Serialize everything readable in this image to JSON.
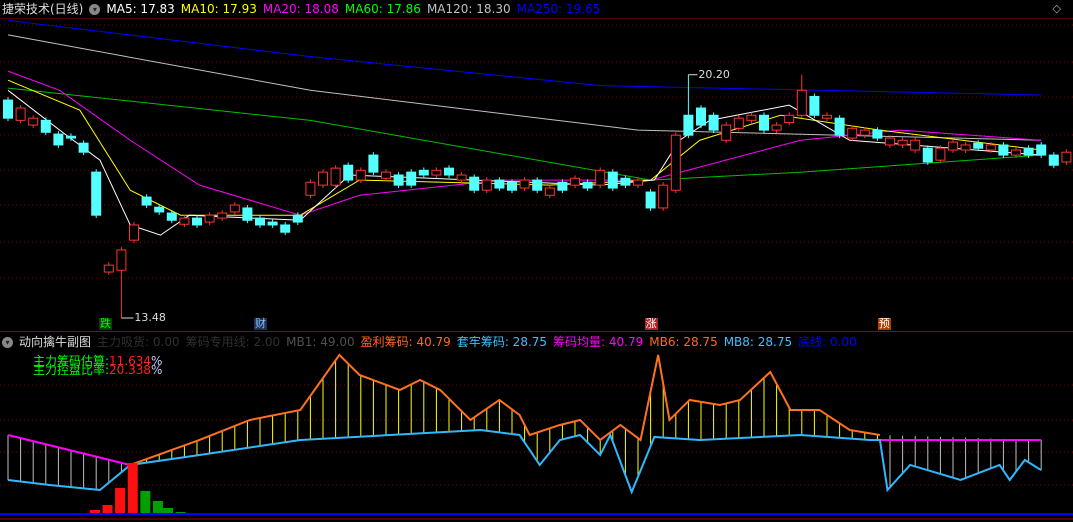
{
  "main": {
    "title": "捷荣技术(日线)",
    "ma": [
      {
        "label": "MA5: 17.83",
        "color": "#ffffff"
      },
      {
        "label": "MA10: 17.93",
        "color": "#ffff00"
      },
      {
        "label": "MA20: 18.08",
        "color": "#ff00ff"
      },
      {
        "label": "MA60: 17.86",
        "color": "#00ff00"
      },
      {
        "label": "MA120: 18.30",
        "color": "#c0c0c0"
      },
      {
        "label": "MA250: 19.65",
        "color": "#0000ff"
      }
    ],
    "high_label": "20.20",
    "low_label": "13.48",
    "markers": [
      {
        "text": "跌",
        "color": "#00ff00",
        "bg": "#004000",
        "idx": 7.7
      },
      {
        "text": "财",
        "color": "#80c0ff",
        "bg": "#203050",
        "idx": 20
      },
      {
        "text": "涨",
        "color": "#ffffff",
        "bg": "#b02020",
        "idx": 51
      },
      {
        "text": "预",
        "color": "#ffffff",
        "bg": "#b04000",
        "idx": 69.5
      }
    ]
  },
  "sub": {
    "title": "动向擒牛副图",
    "indicators": [
      {
        "label": "主力吸货: 0.00",
        "color": "#303030"
      },
      {
        "label": "筹码专用线: 2.00",
        "color": "#303030"
      },
      {
        "label": "MB1: 49.00",
        "color": "#505050"
      },
      {
        "label": "盈利筹码: 40.79",
        "color": "#ff6a20"
      },
      {
        "label": "套牢筹码: 28.75",
        "color": "#40c0ff"
      },
      {
        "label": "筹码均量: 40.79",
        "color": "#ff00ff"
      },
      {
        "label": "MB6: 28.75",
        "color": "#ff6a20"
      },
      {
        "label": "MB8: 28.75",
        "color": "#40c0ff"
      },
      {
        "label": "底线: 0.00",
        "color": "#0000ff"
      }
    ],
    "overlay1_label": "主力筹码估算:",
    "overlay1_value": "11.634",
    "overlay2_label": "主力控盘比率:",
    "overlay2_value": "20.338",
    "percent": "%"
  },
  "colors": {
    "up": "#ff3232",
    "down": "#54ffff",
    "grid": "#800000"
  },
  "chart_data": {
    "type": "candlestick",
    "price_range": [
      13.0,
      21.9
    ],
    "candles": [
      [
        19.5,
        19.0
      ],
      [
        18.94,
        19.28
      ],
      [
        18.81,
        19.0
      ],
      [
        18.94,
        18.61
      ],
      [
        18.56,
        18.26
      ],
      [
        18.5,
        18.45
      ],
      [
        18.31,
        18.06
      ],
      [
        17.51,
        16.32
      ],
      [
        14.75,
        14.94
      ],
      [
        14.8,
        15.36
      ],
      [
        15.63,
        16.05
      ],
      [
        16.82,
        16.6
      ],
      [
        16.54,
        16.41
      ],
      [
        16.38,
        16.18
      ],
      [
        16.07,
        16.24
      ],
      [
        16.24,
        16.05
      ],
      [
        16.13,
        16.32
      ],
      [
        16.24,
        16.38
      ],
      [
        16.41,
        16.6
      ],
      [
        16.52,
        16.18
      ],
      [
        16.24,
        16.05
      ],
      [
        16.13,
        16.05
      ],
      [
        16.05,
        15.85
      ],
      [
        16.32,
        16.13
      ],
      [
        16.87,
        17.23
      ],
      [
        17.15,
        17.51
      ],
      [
        17.15,
        17.62
      ],
      [
        17.7,
        17.29
      ],
      [
        17.29,
        17.56
      ],
      [
        17.98,
        17.51
      ],
      [
        17.34,
        17.51
      ],
      [
        17.43,
        17.15
      ],
      [
        17.51,
        17.15
      ],
      [
        17.56,
        17.43
      ],
      [
        17.43,
        17.56
      ],
      [
        17.62,
        17.43
      ],
      [
        17.29,
        17.43
      ],
      [
        17.37,
        17.01
      ],
      [
        17.01,
        17.29
      ],
      [
        17.29,
        17.07
      ],
      [
        17.23,
        17.01
      ],
      [
        17.07,
        17.29
      ],
      [
        17.29,
        17.01
      ],
      [
        16.87,
        17.07
      ],
      [
        17.23,
        17.01
      ],
      [
        17.15,
        17.34
      ],
      [
        17.23,
        17.07
      ],
      [
        17.15,
        17.56
      ],
      [
        17.51,
        17.07
      ],
      [
        17.34,
        17.15
      ],
      [
        17.15,
        17.29
      ],
      [
        16.96,
        16.52
      ],
      [
        16.52,
        17.15
      ],
      [
        17.01,
        18.53
      ],
      [
        19.08,
        18.53
      ],
      [
        19.28,
        18.81
      ],
      [
        19.08,
        18.67
      ],
      [
        18.39,
        18.81
      ],
      [
        18.72,
        19.0
      ],
      [
        18.94,
        19.08
      ],
      [
        19.08,
        18.67
      ],
      [
        18.67,
        18.81
      ],
      [
        18.88,
        19.08
      ],
      [
        19.08,
        19.77
      ],
      [
        19.6,
        19.08
      ],
      [
        19.0,
        19.08
      ],
      [
        19.0,
        18.53
      ],
      [
        18.45,
        18.72
      ],
      [
        18.53,
        18.67
      ],
      [
        18.67,
        18.45
      ],
      [
        18.26,
        18.45
      ],
      [
        18.26,
        18.39
      ],
      [
        18.12,
        18.39
      ],
      [
        18.17,
        17.79
      ],
      [
        17.84,
        18.17
      ],
      [
        18.12,
        18.34
      ],
      [
        18.12,
        18.26
      ],
      [
        18.31,
        18.17
      ],
      [
        18.12,
        18.26
      ],
      [
        18.26,
        17.98
      ],
      [
        17.98,
        18.12
      ],
      [
        18.17,
        17.98
      ],
      [
        18.26,
        17.98
      ],
      [
        17.98,
        17.7
      ],
      [
        17.79,
        18.06
      ],
      [
        17.98,
        18.12
      ],
      [
        17.84,
        17.98
      ]
    ],
    "special_highs": {
      "9": 13.48,
      "54": 20.2,
      "63": 20.2
    },
    "ma_lines": {
      "MA250": [
        [
          0,
          21.7
        ],
        [
          24,
          20.7
        ],
        [
          47,
          19.9
        ],
        [
          82,
          19.64
        ]
      ],
      "MA120": [
        [
          0,
          21.3
        ],
        [
          24,
          19.77
        ],
        [
          50,
          18.67
        ],
        [
          82,
          18.39
        ]
      ],
      "MA60": [
        [
          0,
          19.83
        ],
        [
          24,
          18.94
        ],
        [
          51,
          17.29
        ],
        [
          63,
          17.51
        ],
        [
          82,
          17.98
        ]
      ],
      "MA20": [
        [
          0,
          20.3
        ],
        [
          4.1,
          19.77
        ],
        [
          9.7,
          18.39
        ],
        [
          15.2,
          17.15
        ],
        [
          23.2,
          16.32
        ],
        [
          27.9,
          16.87
        ],
        [
          39,
          17.29
        ],
        [
          51,
          17.29
        ],
        [
          62.9,
          18.39
        ],
        [
          70.8,
          18.67
        ],
        [
          82,
          18.39
        ]
      ],
      "MA10": [
        [
          0,
          20.05
        ],
        [
          5.7,
          19.22
        ],
        [
          9.7,
          17.01
        ],
        [
          13.7,
          16.32
        ],
        [
          23.2,
          16.32
        ],
        [
          27.9,
          17.29
        ],
        [
          43,
          17.15
        ],
        [
          51,
          17.29
        ],
        [
          54.9,
          18.39
        ],
        [
          61.3,
          19.08
        ],
        [
          69.2,
          18.67
        ],
        [
          82,
          18.12
        ]
      ],
      "MA5": [
        [
          0,
          19.77
        ],
        [
          4.1,
          18.67
        ],
        [
          7.3,
          17.84
        ],
        [
          9.7,
          16.05
        ],
        [
          12.1,
          15.77
        ],
        [
          14.4,
          16.32
        ],
        [
          23.2,
          16.18
        ],
        [
          27.1,
          17.43
        ],
        [
          47,
          17.15
        ],
        [
          51.3,
          17.29
        ],
        [
          53.3,
          18.39
        ],
        [
          55.7,
          18.94
        ],
        [
          62,
          19.36
        ],
        [
          66.8,
          18.39
        ],
        [
          82,
          17.98
        ]
      ]
    },
    "sub_series": {
      "profit_chips": [
        [
          0,
          42.8
        ],
        [
          9.7,
          30.8
        ],
        [
          15.2,
          40.8
        ],
        [
          19.2,
          48.8
        ],
        [
          23.2,
          52.8
        ],
        [
          26.3,
          74.8
        ],
        [
          27.9,
          66.8
        ],
        [
          31.1,
          60.8
        ],
        [
          32.7,
          64.8
        ],
        [
          34.3,
          60.8
        ],
        [
          36.7,
          48.8
        ],
        [
          39,
          56.8
        ],
        [
          40.6,
          50.8
        ],
        [
          41.4,
          42.8
        ],
        [
          43.8,
          46.8
        ],
        [
          45.4,
          48.8
        ],
        [
          47,
          40.8
        ],
        [
          48.6,
          46.8
        ],
        [
          50.2,
          40.8
        ],
        [
          51.6,
          74.8
        ],
        [
          52.5,
          48.8
        ],
        [
          54.1,
          56.8
        ],
        [
          56.5,
          54.8
        ],
        [
          58.1,
          56.8
        ],
        [
          60.5,
          68
        ],
        [
          62.1,
          52.8
        ],
        [
          64.4,
          52.8
        ],
        [
          66.8,
          44.8
        ],
        [
          69.2,
          42.8
        ],
        [
          82,
          40.79
        ]
      ],
      "trapped_chips": [
        [
          0,
          24.8
        ],
        [
          3.3,
          22.8
        ],
        [
          7.3,
          20.8
        ],
        [
          9.7,
          30.8
        ],
        [
          15.2,
          34.8
        ],
        [
          23.2,
          40.8
        ],
        [
          37.5,
          44.8
        ],
        [
          40.6,
          42.8
        ],
        [
          42.2,
          30.8
        ],
        [
          43.8,
          40.8
        ],
        [
          45.4,
          42.8
        ],
        [
          47,
          34.8
        ],
        [
          47.8,
          42.8
        ],
        [
          49.5,
          20
        ],
        [
          51.3,
          42
        ],
        [
          54.9,
          40.8
        ],
        [
          62.9,
          42.8
        ],
        [
          68.4,
          40.8
        ],
        [
          69.2,
          40.8
        ],
        [
          69.8,
          20.8
        ],
        [
          71.6,
          30.8
        ],
        [
          75.6,
          24.8
        ],
        [
          78.7,
          30.8
        ],
        [
          79.5,
          24.8
        ],
        [
          80.7,
          32.8
        ],
        [
          82,
          28.75
        ]
      ],
      "avg_chips": [
        [
          0,
          42.8
        ],
        [
          9.7,
          30.8
        ]
      ],
      "avg_chips_right": [
        [
          69.2,
          40.8
        ],
        [
          82,
          40.79
        ]
      ],
      "bars_red": [
        [
          6.9,
          3
        ],
        [
          7.9,
          8
        ],
        [
          8.9,
          25
        ],
        [
          9.9,
          50
        ]
      ],
      "bars_green": [
        [
          10.9,
          22
        ],
        [
          11.9,
          12
        ],
        [
          12.7,
          5
        ],
        [
          13.7,
          1
        ]
      ]
    }
  }
}
